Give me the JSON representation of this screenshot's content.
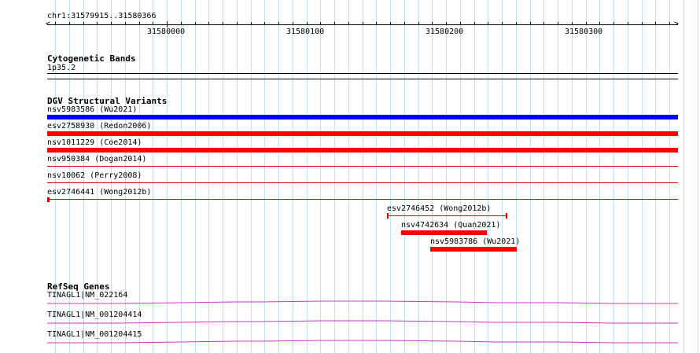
{
  "ruler": {
    "region": "chr1:31579915..31580366",
    "ticks": [
      "31580000",
      "31580100",
      "31580200",
      "31580300"
    ]
  },
  "cytoband": {
    "title": "Cytogenetic Bands",
    "band": "1p35.2"
  },
  "dgv": {
    "title": "DGV Structural Variants",
    "variants": [
      {
        "label": "nsv5983586 (Wu2021)",
        "color": "#0000ff"
      },
      {
        "label": "esv2758930 (Redon2006)",
        "color": "#ff0000"
      },
      {
        "label": "nsv1011229 (Coe2014)",
        "color": "#ff0000"
      },
      {
        "label": "nsv950384 (Dogan2014)",
        "color": "#d00000"
      },
      {
        "label": "nsv10062 (Perry2008)",
        "color": "#d00000"
      },
      {
        "label": "esv2746441 (Wong2012b)",
        "color": "#d00000"
      },
      {
        "label": "esv2746452 (Wong2012b)",
        "color": "#d00000"
      },
      {
        "label": "nsv4742634 (Quan2021)",
        "color": "#ff0000"
      },
      {
        "label": "nsv5983786 (Wu2021)",
        "color": "#ff0000"
      }
    ]
  },
  "refseq": {
    "title": "RefSeq Genes",
    "genes": [
      {
        "label": "TINAGL1|NM_022164",
        "color": "#cc33cc"
      },
      {
        "label": "TINAGL1|NM_001204414",
        "color": "#cc33cc"
      },
      {
        "label": "TINAGL1|NM_001204415",
        "color": "#cc33cc"
      }
    ]
  }
}
